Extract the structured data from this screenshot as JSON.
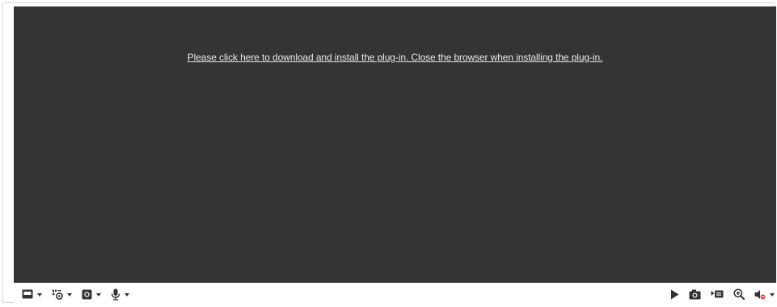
{
  "video": {
    "plugin_message": "Please click here to download and install the plug-in. Close the browser when installing the plug-in."
  },
  "toolbar_left": [
    {
      "name": "window-layout-icon",
      "has_dropdown": true
    },
    {
      "name": "stream-type-icon",
      "has_dropdown": true
    },
    {
      "name": "video-preview-icon",
      "has_dropdown": true
    },
    {
      "name": "microphone-icon",
      "has_dropdown": true
    }
  ],
  "toolbar_right": [
    {
      "name": "play-icon",
      "has_dropdown": false
    },
    {
      "name": "camera-capture-icon",
      "has_dropdown": false
    },
    {
      "name": "record-icon",
      "has_dropdown": false
    },
    {
      "name": "zoom-in-icon",
      "has_dropdown": false
    },
    {
      "name": "audio-muted-icon",
      "has_dropdown": true
    }
  ],
  "colors": {
    "video_background": "#343434",
    "link_text": "#e8e8e8",
    "icon": "#333333",
    "mute_accent": "#e0443c"
  }
}
